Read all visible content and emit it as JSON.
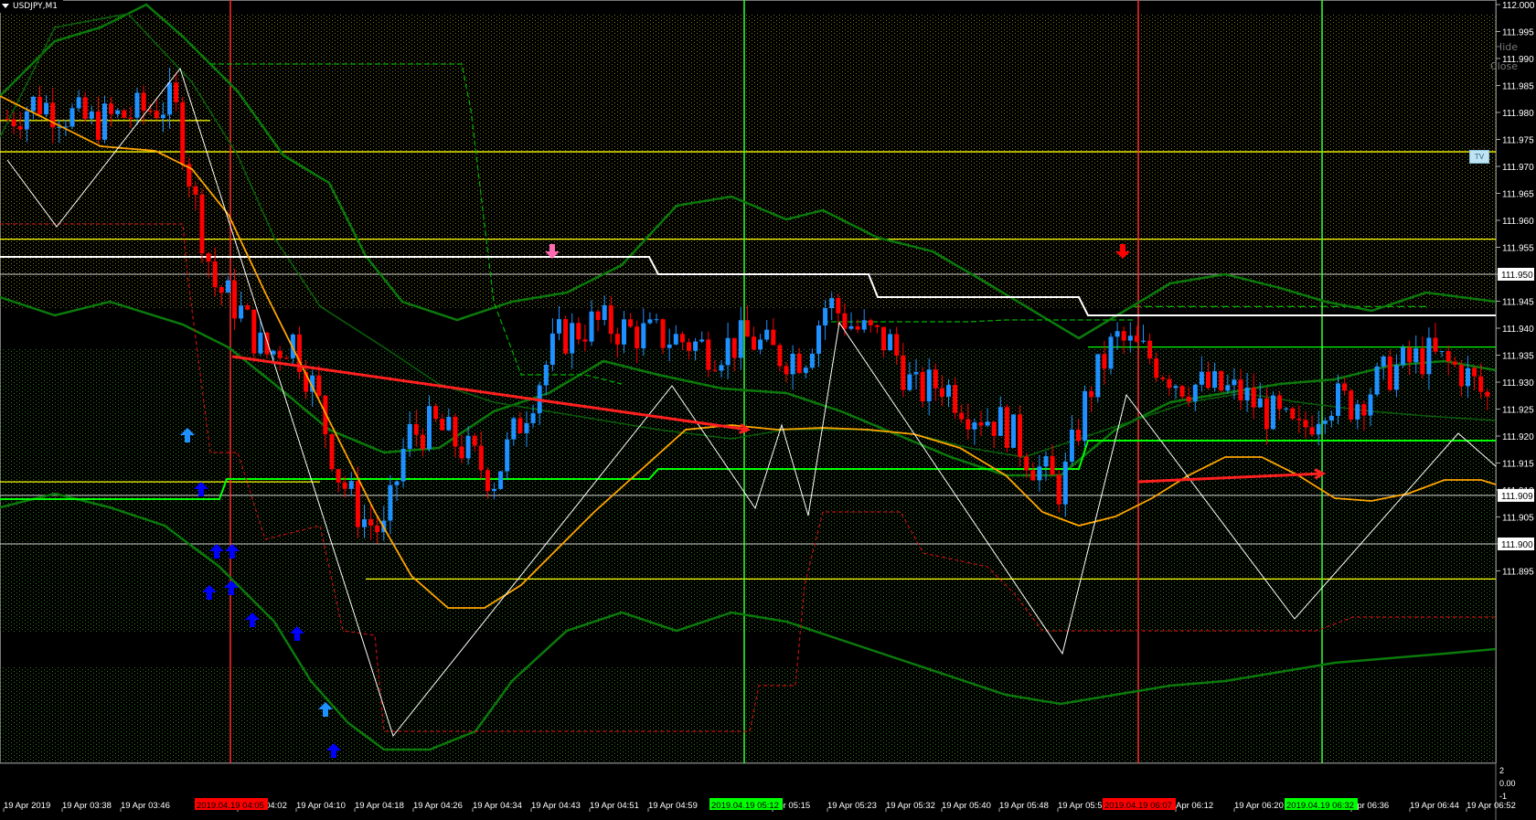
{
  "window": {
    "title": "USDJPY,M1"
  },
  "side_labels": {
    "hide": "Hide",
    "close": "Close",
    "tv": "TV"
  },
  "price_axis": {
    "ticks": [
      "112.000",
      "111.995",
      "111.990",
      "111.985",
      "111.980",
      "111.975",
      "111.970",
      "111.965",
      "111.960",
      "111.955",
      "111.950",
      "111.945",
      "111.940",
      "111.935",
      "111.930",
      "111.925",
      "111.920",
      "111.915",
      "111.910",
      "111.905",
      "111.900",
      "111.895"
    ],
    "boxed_labels": [
      "111.950",
      "111.909",
      "111.900"
    ],
    "sub_window_labels": [
      "2",
      "0.00",
      "-1"
    ]
  },
  "time_axis": {
    "labels": [
      "19 Apr 2019",
      "19 Apr 03:38",
      "19 Apr 03:46",
      "19 Apr 04:02",
      "19 Apr 04:10",
      "19 Apr 04:18",
      "19 Apr 04:26",
      "19 Apr 04:34",
      "19 Apr 04:43",
      "19 Apr 04:51",
      "19 Apr 04:59",
      "Apr 05:15",
      "19 Apr 05:23",
      "19 Apr 05:32",
      "19 Apr 05:40",
      "19 Apr 05:48",
      "19 Apr 05:5",
      "Apr 06:12",
      "19 Apr 06:20",
      "Apr 06:36",
      "19 Apr 06:44",
      "19 Apr 06:52"
    ],
    "markers": [
      {
        "label": "2019.04.19 04:05",
        "color": "#ff0000"
      },
      {
        "label": "2019.04.19 05:12",
        "color": "#00ff00"
      },
      {
        "label": "2019.04.19 06:07",
        "color": "#ff0000"
      },
      {
        "label": "2019.04.19 06:32",
        "color": "#00ff00"
      }
    ]
  },
  "colors": {
    "background": "#000000",
    "bull_candle": "#1e90ff",
    "bear_candle": "#ff0000",
    "bands": "#0b7a0b",
    "moving_average": "#ffa500",
    "zigzag": "#ffffff",
    "trend_arrow": "#ff2020",
    "resistance": "#ffff00",
    "support": "#00ff00",
    "up_arrow_a": "#1e90ff",
    "up_arrow_b": "#0000ff",
    "down_arrow_a": "#ff69b4",
    "down_arrow_b": "#ff0000"
  }
}
